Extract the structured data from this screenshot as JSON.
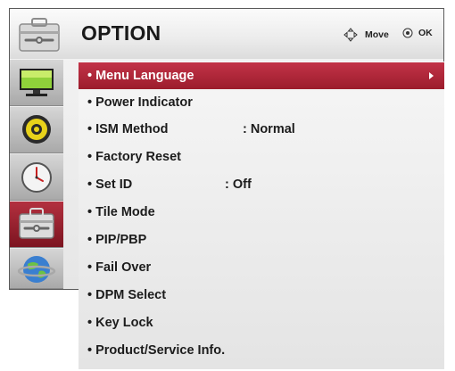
{
  "header": {
    "title": "OPTION",
    "move_label": "Move",
    "ok_label": "OK",
    "icon": "toolbox-icon"
  },
  "sidebar": {
    "items": [
      {
        "name": "picture",
        "icon": "monitor-icon"
      },
      {
        "name": "audio",
        "icon": "speaker-icon"
      },
      {
        "name": "time",
        "icon": "clock-icon"
      },
      {
        "name": "option",
        "icon": "toolbox-icon",
        "active": true
      },
      {
        "name": "network",
        "icon": "globe-icon"
      }
    ]
  },
  "menu": {
    "items": [
      {
        "label": "• Menu Language",
        "value": "",
        "selected": true
      },
      {
        "label": "• Power Indicator",
        "value": ""
      },
      {
        "label": "• ISM Method",
        "value": ": Normal"
      },
      {
        "label": "• Factory Reset",
        "value": ""
      },
      {
        "label": "• Set ID",
        "value": ": Off"
      },
      {
        "label": "• Tile Mode",
        "value": ""
      },
      {
        "label": "• PIP/PBP",
        "value": ""
      },
      {
        "label": "• Fail Over",
        "value": ""
      },
      {
        "label": "• DPM Select",
        "value": ""
      },
      {
        "label": "• Key Lock",
        "value": ""
      },
      {
        "label": "• Product/Service Info.",
        "value": ""
      }
    ]
  },
  "colors": {
    "accent": "#b02838",
    "panel": "#e9e9e9",
    "text": "#1c1c1c"
  }
}
